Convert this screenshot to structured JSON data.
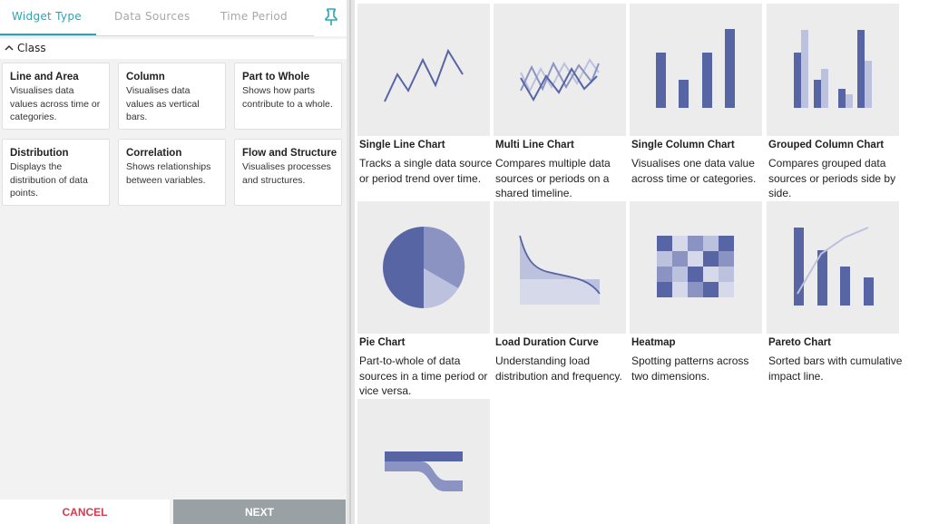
{
  "tabs": [
    {
      "label": "Widget Type",
      "active": true
    },
    {
      "label": "Data Sources",
      "active": false
    },
    {
      "label": "Time Period",
      "active": false
    }
  ],
  "pin_icon": "pin-icon",
  "class_section": {
    "label": "Class",
    "expanded": true,
    "cards": [
      {
        "title": "Line and Area",
        "desc": "Visualises data values across time or categories."
      },
      {
        "title": "Column",
        "desc": "Visualises data values as vertical bars."
      },
      {
        "title": "Part to Whole",
        "desc": "Shows how parts contribute to a whole."
      },
      {
        "title": "Distribution",
        "desc": "Displays the distribution of data points."
      },
      {
        "title": "Correlation",
        "desc": "Shows relationships between variables."
      },
      {
        "title": "Flow and Structure",
        "desc": "Visualises processes and structures."
      }
    ]
  },
  "buttons": {
    "cancel": "CANCEL",
    "next": "NEXT"
  },
  "widgets": [
    {
      "title": "Single Line Chart",
      "desc": "Tracks a single data source or period trend over time.",
      "icon": "single-line-chart-icon"
    },
    {
      "title": "Multi Line Chart",
      "desc": "Compares multiple data sources or periods on a shared timeline.",
      "icon": "multi-line-chart-icon"
    },
    {
      "title": "Single Column Chart",
      "desc": "Visualises one data value across time or categories.",
      "icon": "single-column-chart-icon"
    },
    {
      "title": "Grouped Column Chart",
      "desc": "Compares grouped data sources or periods side by side.",
      "icon": "grouped-column-chart-icon"
    },
    {
      "title": "Pie Chart",
      "desc": "Part-to-whole of data sources in a time period or vice versa.",
      "icon": "pie-chart-icon"
    },
    {
      "title": "Load Duration Curve",
      "desc": "Understanding load distribution and frequency.",
      "icon": "load-duration-curve-icon"
    },
    {
      "title": "Heatmap",
      "desc": "Spotting patterns across two dimensions.",
      "icon": "heatmap-icon"
    },
    {
      "title": "Pareto Chart",
      "desc": "Sorted bars with cumulative impact line.",
      "icon": "pareto-chart-icon"
    },
    {
      "title": "",
      "desc": "",
      "icon": "flow-chart-icon"
    }
  ],
  "colors": {
    "accent": "#2aa5b5",
    "cancel_text": "#d63a4f",
    "next_bg": "#9aa1a5",
    "chart_dark": "#5865a5",
    "chart_mid": "#8a93c2",
    "chart_light": "#bcc2de"
  }
}
